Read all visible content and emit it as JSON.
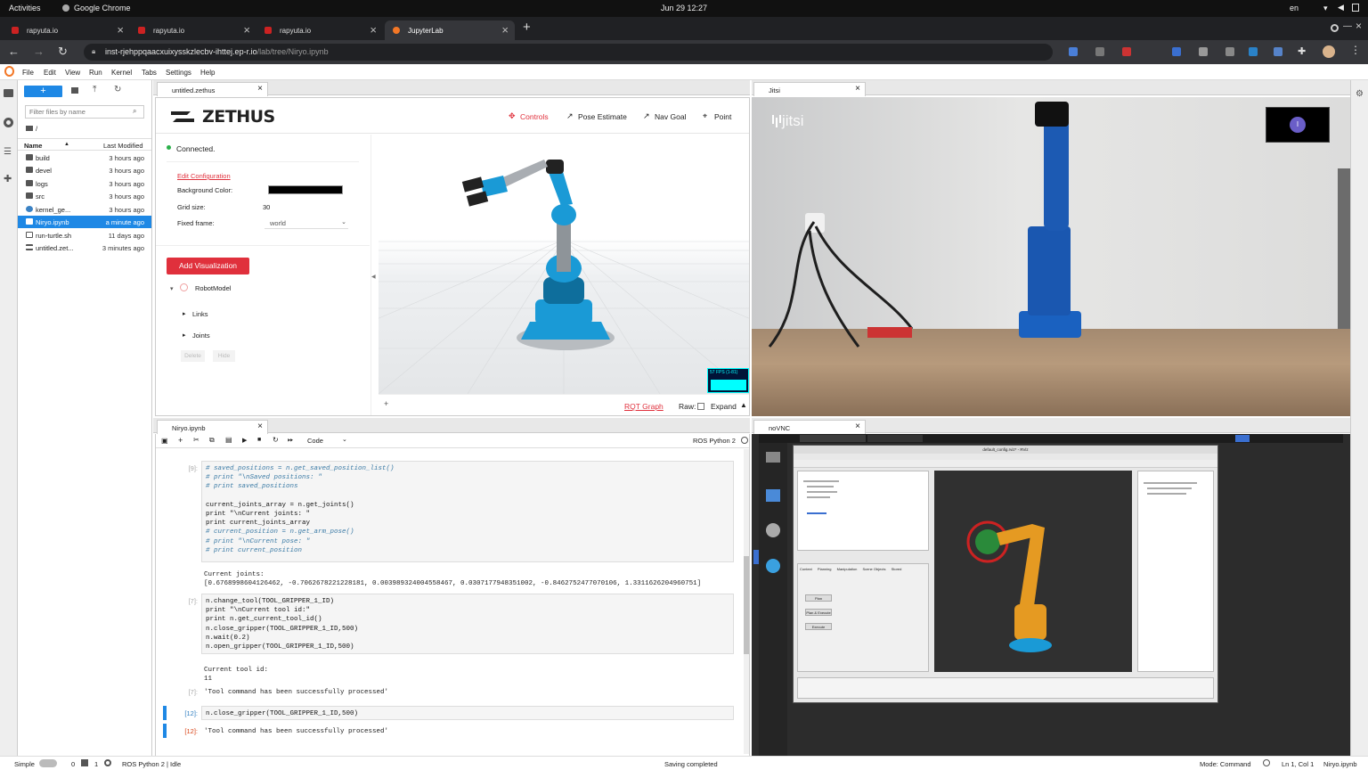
{
  "gnome": {
    "activities": "Activities",
    "app": "Google Chrome",
    "clock": "Jun 29  12:27",
    "lang": "en"
  },
  "browser": {
    "tabs": [
      {
        "label": "rapyuta.io"
      },
      {
        "label": "rapyuta.io"
      },
      {
        "label": "rapyuta.io"
      },
      {
        "label": "JupyterLab"
      }
    ],
    "url_host": "inst-rjehppqaacxuixysskzlecbv-ihttej.ep-r.io",
    "url_path": "/lab/tree/Niryo.ipynb"
  },
  "menu": [
    "File",
    "Edit",
    "View",
    "Run",
    "Kernel",
    "Tabs",
    "Settings",
    "Help"
  ],
  "filebrowser": {
    "filter_placeholder": "Filter files by name",
    "path": "/",
    "col_name": "Name",
    "col_modified": "Last Modified",
    "files": [
      {
        "name": "build",
        "modified": "3 hours ago"
      },
      {
        "name": "devel",
        "modified": "3 hours ago"
      },
      {
        "name": "logs",
        "modified": "3 hours ago"
      },
      {
        "name": "src",
        "modified": "3 hours ago"
      },
      {
        "name": "kernel_ge...",
        "modified": "3 hours ago"
      },
      {
        "name": "Niryo.ipynb",
        "modified": "a minute ago"
      },
      {
        "name": "run-turtle.sh",
        "modified": "11 days ago"
      },
      {
        "name": "untitled.zet...",
        "modified": "3 minutes ago"
      }
    ]
  },
  "zethus": {
    "tab": "untitled.zethus",
    "logo": "ZETHUS",
    "nav": [
      "Controls",
      "Pose Estimate",
      "Nav Goal",
      "Point"
    ],
    "status": "Connected.",
    "edit_config": "Edit Configuration",
    "bg_label": "Background Color:",
    "grid_label": "Grid size:",
    "grid_value": "30",
    "frame_label": "Fixed frame:",
    "frame_value": "world",
    "add_viz": "Add Visualization",
    "robot_model": "RobotModel",
    "links": "Links",
    "joints": "Joints",
    "delete": "Delete",
    "hide": "Hide",
    "fps": "57 FPS (1-81)",
    "rqt": "RQT Graph",
    "raw": "Raw:",
    "expand": "Expand"
  },
  "jitsi": {
    "tab": "Jitsi",
    "logo": "jitsi",
    "avatar": "I"
  },
  "notebook": {
    "tab": "Niryo.ipynb",
    "celltype": "Code",
    "kernel": "ROS Python 2",
    "cell1_prompt": "[9]:",
    "cell1": [
      "# saved_positions = n.get_saved_position_list()",
      "# print \"\\nSaved positions: \"",
      "# print saved_positions",
      "",
      "current_joints_array = n.get_joints()",
      "print \"\\nCurrent joints: \"",
      "print current_joints_array",
      "# current_position = n.get_arm_pose()",
      "# print \"\\nCurrent pose: \"",
      "# print current_position"
    ],
    "out1_label": "Current joints:",
    "out1": "[0.6768998604126462, -0.7062678221228181, 0.003989324004558467, 0.0307177948351002, -0.8462752477070106, 1.3311626204960751]",
    "cell2_prompt": "[7]:",
    "cell2": [
      "n.change_tool(TOOL_GRIPPER_1_ID)",
      "print \"\\nCurrent tool id:\"",
      "print n.get_current_tool_id()",
      "n.close_gripper(TOOL_GRIPPER_1_ID,500)",
      "n.wait(0.2)",
      "n.open_gripper(TOOL_GRIPPER_1_ID,500)"
    ],
    "out2_label": "Current tool id:",
    "out2_value": "11",
    "out2_prompt": "[7]:",
    "out2_result": "'Tool command has been successfully processed'",
    "cell3_prompt": "[12]:",
    "cell3": "n.close_gripper(TOOL_GRIPPER_1_ID,500)",
    "out3_prompt": "[12]:",
    "out3_result": "'Tool command has been successfully processed'"
  },
  "novnc": {
    "tab": "noVNC",
    "window_title": "default_config.rviz* - RViz",
    "tabs": [
      "Context",
      "Planning",
      "Manipulation",
      "Scene Objects",
      "Stored"
    ],
    "planning_buttons": [
      "Plan",
      "Plan & Execute",
      "Execute"
    ]
  },
  "status": {
    "mode": "Simple",
    "zero": "0",
    "one": "1",
    "kernel": "ROS Python 2 | Idle",
    "saving": "Saving completed",
    "cmd": "Mode: Command",
    "pos": "Ln 1, Col 1",
    "file": "Niryo.ipynb"
  },
  "colors": {
    "accent": "#1e88e5",
    "zethus_red": "#e0303c",
    "robot_blue": "#1a9ad6",
    "chrome_dark": "#202124"
  }
}
